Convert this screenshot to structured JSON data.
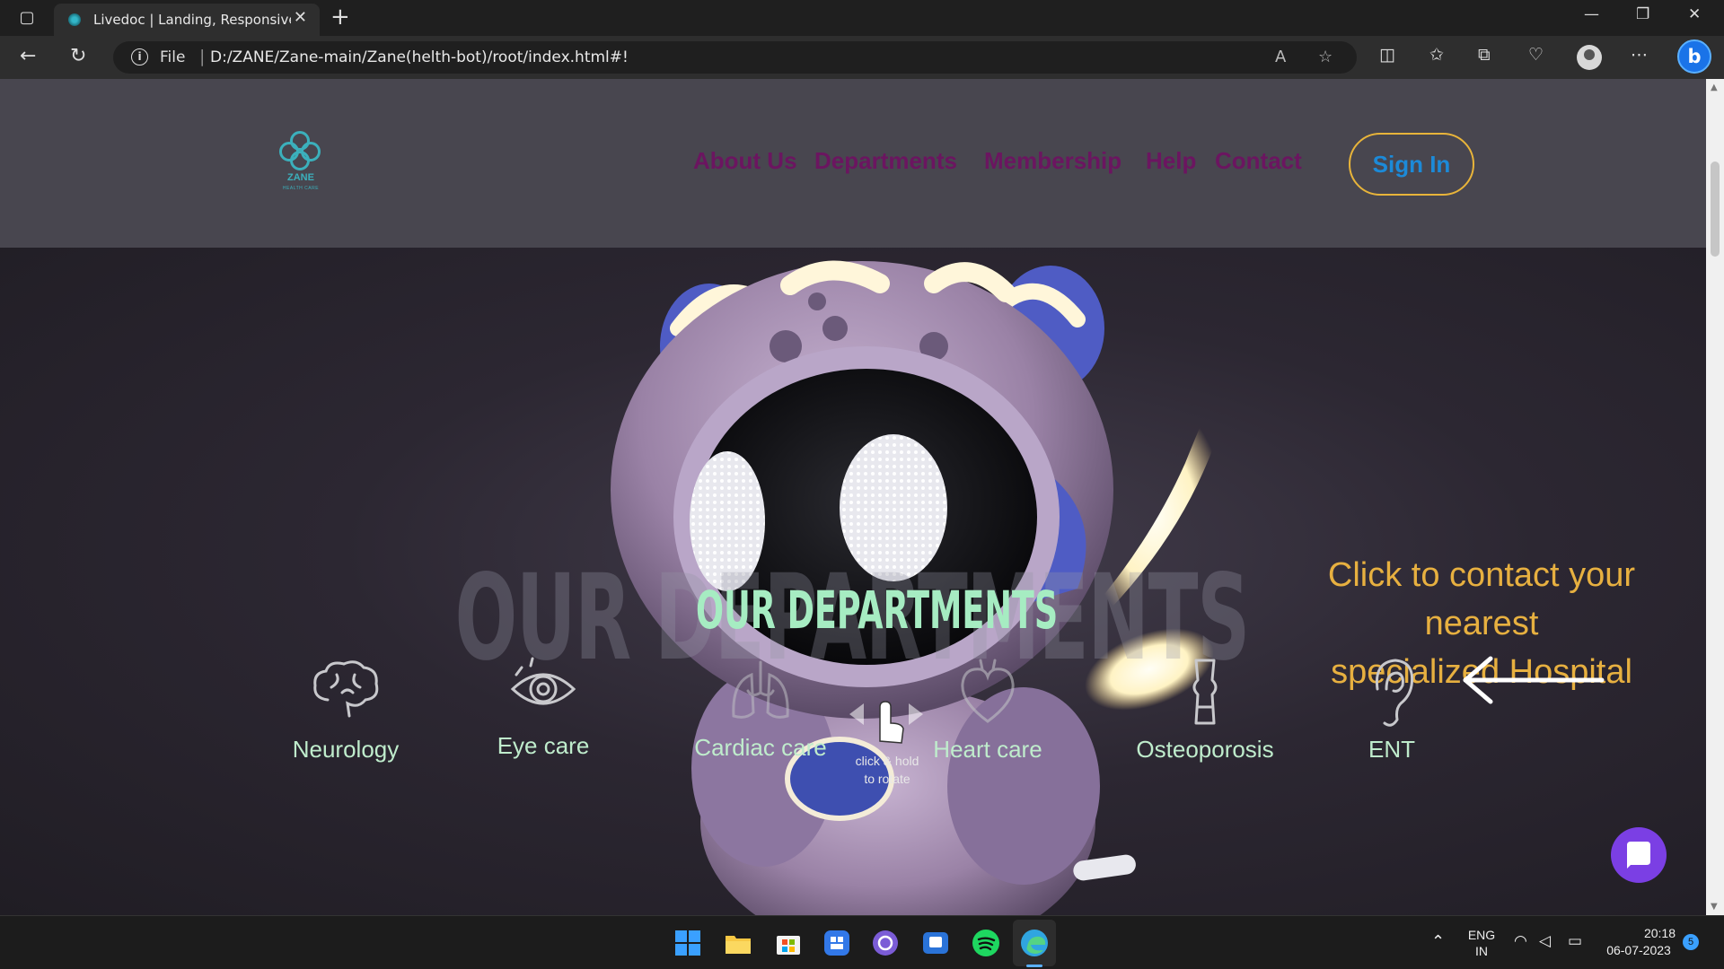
{
  "browser": {
    "tab_title": "Livedoc | Landing, Responsive &",
    "scheme_label": "File",
    "url": "D:/ZANE/Zane-main/Zane(helth-bot)/root/index.html#!"
  },
  "site": {
    "logo_name": "ZANE",
    "logo_tag": "HEALTH CARE",
    "nav": [
      "About Us",
      "Departments",
      "Membership",
      "Help",
      "Contact"
    ],
    "sign_in": "Sign In",
    "colors": {
      "nav": "#6b1560",
      "sign_in_border": "#e8b43a",
      "sign_in_text": "#1c8ad8",
      "title": "#a6ecc2",
      "contact": "#e7b040"
    }
  },
  "hero": {
    "watermark": "OUR DEPARTMENTS",
    "title": "OUR DEPARTMENTS",
    "contact_lines": [
      "Click to contact your",
      "nearest",
      "specialized Hospital"
    ],
    "rotate_hint": [
      "click & hold",
      "to rotate"
    ]
  },
  "departments": [
    {
      "label": "Neurology",
      "icon": "brain-icon"
    },
    {
      "label": "Eye care",
      "icon": "eye-icon"
    },
    {
      "label": "Cardiac care",
      "icon": "lungs-icon"
    },
    {
      "label": "Heart care",
      "icon": "heart-icon"
    },
    {
      "label": "Osteoporosis",
      "icon": "bone-joint-icon"
    },
    {
      "label": "ENT",
      "icon": "ear-icon"
    }
  ],
  "taskbar": {
    "lang": "ENG",
    "region": "IN",
    "time": "20:18",
    "date": "06-07-2023",
    "notifications": "5"
  }
}
